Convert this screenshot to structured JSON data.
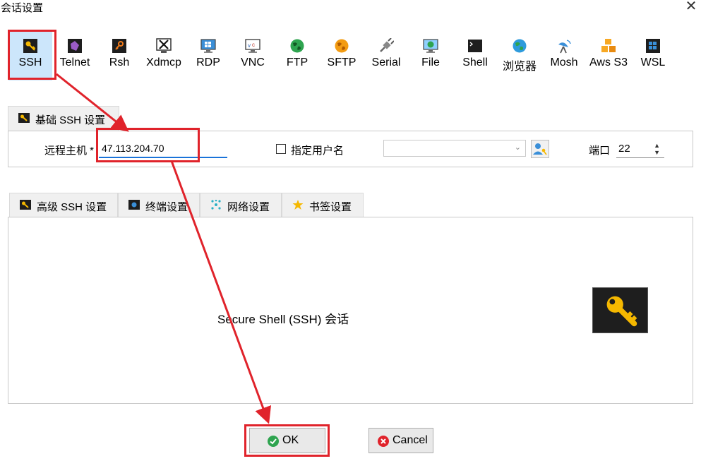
{
  "window": {
    "title": "会话设置",
    "close_glyph": "✕"
  },
  "protocols": [
    {
      "label": "SSH",
      "icon": "ssh-key-icon",
      "active": true
    },
    {
      "label": "Telnet",
      "icon": "telnet-icon"
    },
    {
      "label": "Rsh",
      "icon": "rsh-icon"
    },
    {
      "label": "Xdmcp",
      "icon": "xdmcp-icon"
    },
    {
      "label": "RDP",
      "icon": "rdp-monitor-icon"
    },
    {
      "label": "VNC",
      "icon": "vnc-monitor-icon"
    },
    {
      "label": "FTP",
      "icon": "ftp-globe-icon"
    },
    {
      "label": "SFTP",
      "icon": "sftp-globe-icon"
    },
    {
      "label": "Serial",
      "icon": "serial-plug-icon"
    },
    {
      "label": "File",
      "icon": "file-monitor-icon"
    },
    {
      "label": "Shell",
      "icon": "shell-terminal-icon"
    },
    {
      "label": "浏览器",
      "icon": "browser-globe-icon"
    },
    {
      "label": "Mosh",
      "icon": "mosh-antenna-icon"
    },
    {
      "label": "Aws S3",
      "icon": "aws-s3-cubes-icon"
    },
    {
      "label": "WSL",
      "icon": "wsl-windows-icon"
    }
  ],
  "basic": {
    "tab_label": "基础 SSH 设置",
    "remote_host_label": "远程主机 *",
    "remote_host_value": "47.113.204.70",
    "specify_username_label": "指定用户名",
    "username_value": "",
    "port_label": "端口",
    "port_value": "22"
  },
  "advanced_tabs": [
    {
      "label": "高级 SSH 设置",
      "icon": "key-icon"
    },
    {
      "label": "终端设置",
      "icon": "terminal-icon"
    },
    {
      "label": "网络设置",
      "icon": "network-icon"
    },
    {
      "label": "书签设置",
      "icon": "star-icon"
    }
  ],
  "panel": {
    "description": "Secure Shell (SSH) 会话"
  },
  "buttons": {
    "ok_label": "OK",
    "cancel_label": "Cancel"
  },
  "colors": {
    "annotation_red": "#e0232b",
    "selected_bg": "#cce6fb",
    "input_focus_blue": "#1a73d9"
  }
}
